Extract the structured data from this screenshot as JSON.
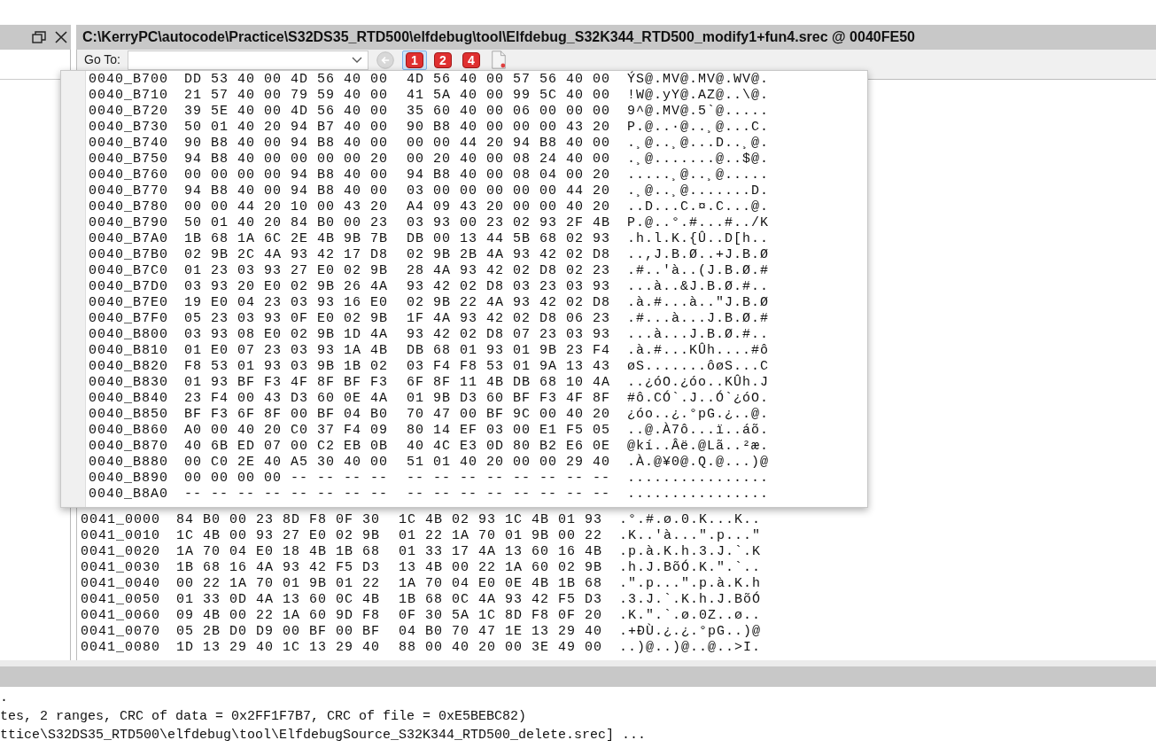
{
  "title_bar": {
    "title": "C:\\KerryPC\\autocode\\Practice\\S32DS35_RTD500\\elfdebug\\tool\\Elfdebug_S32K344_RTD500_modify1+fun4.srec @ 0040FE50"
  },
  "toolbar": {
    "goto_label": "Go To:",
    "back_disabled": true,
    "width_buttons": [
      {
        "label": "1",
        "selected": true
      },
      {
        "label": "2",
        "selected": false
      },
      {
        "label": "4",
        "selected": false
      }
    ]
  },
  "popup": {
    "rows": [
      {
        "address": "0040_B700",
        "bytes_1": "DD 53 40 00 4D 56 40 00",
        "bytes_2": "4D 56 40 00 57 56 40 00",
        "ascii": "ÝS@.MV@.MV@.WV@."
      },
      {
        "address": "0040_B710",
        "bytes_1": "21 57 40 00 79 59 40 00",
        "bytes_2": "41 5A 40 00 99 5C 40 00",
        "ascii": "!W@.yY@.AZ@..\\@."
      },
      {
        "address": "0040_B720",
        "bytes_1": "39 5E 40 00 4D 56 40 00",
        "bytes_2": "35 60 40 00 06 00 00 00",
        "ascii": "9^@.MV@.5`@....."
      },
      {
        "address": "0040_B730",
        "bytes_1": "50 01 40 20 94 B7 40 00",
        "bytes_2": "90 B8 40 00 00 00 43 20",
        "ascii": "P.@..·@..¸@...C."
      },
      {
        "address": "0040_B740",
        "bytes_1": "90 B8 40 00 94 B8 40 00",
        "bytes_2": "00 00 44 20 94 B8 40 00",
        "ascii": ".¸@..¸@...D..¸@."
      },
      {
        "address": "0040_B750",
        "bytes_1": "94 B8 40 00 00 00 00 20",
        "bytes_2": "00 20 40 00 08 24 40 00",
        "ascii": ".¸@.......@..$@."
      },
      {
        "address": "0040_B760",
        "bytes_1": "00 00 00 00 94 B8 40 00",
        "bytes_2": "94 B8 40 00 08 04 00 20",
        "ascii": ".....¸@..¸@....."
      },
      {
        "address": "0040_B770",
        "bytes_1": "94 B8 40 00 94 B8 40 00",
        "bytes_2": "03 00 00 00 00 00 44 20",
        "ascii": ".¸@..¸@.......D."
      },
      {
        "address": "0040_B780",
        "bytes_1": "00 00 44 20 10 00 43 20",
        "bytes_2": "A4 09 43 20 00 00 40 20",
        "ascii": "..D...C.¤.C...@."
      },
      {
        "address": "0040_B790",
        "bytes_1": "50 01 40 20 84 B0 00 23",
        "bytes_2": "03 93 00 23 02 93 2F 4B",
        "ascii": "P.@..°.#...#../K"
      },
      {
        "address": "0040_B7A0",
        "bytes_1": "1B 68 1A 6C 2E 4B 9B 7B",
        "bytes_2": "DB 00 13 44 5B 68 02 93",
        "ascii": ".h.l.K.{Û..D[h.."
      },
      {
        "address": "0040_B7B0",
        "bytes_1": "02 9B 2C 4A 93 42 17 D8",
        "bytes_2": "02 9B 2B 4A 93 42 02 D8",
        "ascii": "..,J.B.Ø..+J.B.Ø"
      },
      {
        "address": "0040_B7C0",
        "bytes_1": "01 23 03 93 27 E0 02 9B",
        "bytes_2": "28 4A 93 42 02 D8 02 23",
        "ascii": ".#..'à..(J.B.Ø.#"
      },
      {
        "address": "0040_B7D0",
        "bytes_1": "03 93 20 E0 02 9B 26 4A",
        "bytes_2": "93 42 02 D8 03 23 03 93",
        "ascii": "...à..&J.B.Ø.#.."
      },
      {
        "address": "0040_B7E0",
        "bytes_1": "19 E0 04 23 03 93 16 E0",
        "bytes_2": "02 9B 22 4A 93 42 02 D8",
        "ascii": ".à.#...à..\"J.B.Ø"
      },
      {
        "address": "0040_B7F0",
        "bytes_1": "05 23 03 93 0F E0 02 9B",
        "bytes_2": "1F 4A 93 42 02 D8 06 23",
        "ascii": ".#...à...J.B.Ø.#"
      },
      {
        "address": "0040_B800",
        "bytes_1": "03 93 08 E0 02 9B 1D 4A",
        "bytes_2": "93 42 02 D8 07 23 03 93",
        "ascii": "...à...J.B.Ø.#.."
      },
      {
        "address": "0040_B810",
        "bytes_1": "01 E0 07 23 03 93 1A 4B",
        "bytes_2": "DB 68 01 93 01 9B 23 F4",
        "ascii": ".à.#...KÛh....#ô"
      },
      {
        "address": "0040_B820",
        "bytes_1": "F8 53 01 93 03 9B 1B 02",
        "bytes_2": "03 F4 F8 53 01 9A 13 43",
        "ascii": "øS.......ôøS...C"
      },
      {
        "address": "0040_B830",
        "bytes_1": "01 93 BF F3 4F 8F BF F3",
        "bytes_2": "6F 8F 11 4B DB 68 10 4A",
        "ascii": "..¿óO.¿óo..KÛh.J"
      },
      {
        "address": "0040_B840",
        "bytes_1": "23 F4 00 43 D3 60 0E 4A",
        "bytes_2": "01 9B D3 60 BF F3 4F 8F",
        "ascii": "#ô.CÓ`.J..Ó`¿óO."
      },
      {
        "address": "0040_B850",
        "bytes_1": "BF F3 6F 8F 00 BF 04 B0",
        "bytes_2": "70 47 00 BF 9C 00 40 20",
        "ascii": "¿óo..¿.°pG.¿..@."
      },
      {
        "address": "0040_B860",
        "bytes_1": "A0 00 40 20 C0 37 F4 09",
        "bytes_2": "80 14 EF 03 00 E1 F5 05",
        "ascii": "..@.À7ô...ï..áõ."
      },
      {
        "address": "0040_B870",
        "bytes_1": "40 6B ED 07 00 C2 EB 0B",
        "bytes_2": "40 4C E3 0D 80 B2 E6 0E",
        "ascii": "@kí..Âë.@Lã..²æ."
      },
      {
        "address": "0040_B880",
        "bytes_1": "00 C0 2E 40 A5 30 40 00",
        "bytes_2": "51 01 40 20 00 00 29 40",
        "ascii": ".À.@¥0@.Q.@...)@"
      },
      {
        "address": "0040_B890",
        "bytes_1": "00 00 00 00 -- -- -- --",
        "bytes_2": "-- -- -- -- -- -- -- --",
        "ascii": "................"
      },
      {
        "address": "0040_B8A0",
        "bytes_1": "-- -- -- -- -- -- -- --",
        "bytes_2": "-- -- -- -- -- -- -- --",
        "ascii": "................"
      }
    ]
  },
  "hex_view": {
    "rows": [
      {
        "address": "0041_0000",
        "bytes_1": "84 B0 00 23 8D F8 0F 30",
        "bytes_2": "1C 4B 02 93 1C 4B 01 93",
        "ascii": ".°.#.ø.0.K...K.."
      },
      {
        "address": "0041_0010",
        "bytes_1": "1C 4B 00 93 27 E0 02 9B",
        "bytes_2": "01 22 1A 70 01 9B 00 22",
        "ascii": ".K..'à...\".p...\""
      },
      {
        "address": "0041_0020",
        "bytes_1": "1A 70 04 E0 18 4B 1B 68",
        "bytes_2": "01 33 17 4A 13 60 16 4B",
        "ascii": ".p.à.K.h.3.J.`.K"
      },
      {
        "address": "0041_0030",
        "bytes_1": "1B 68 16 4A 93 42 F5 D3",
        "bytes_2": "13 4B 00 22 1A 60 02 9B",
        "ascii": ".h.J.BõÓ.K.\".`.."
      },
      {
        "address": "0041_0040",
        "bytes_1": "00 22 1A 70 01 9B 01 22",
        "bytes_2": "1A 70 04 E0 0E 4B 1B 68",
        "ascii": ".\".p...\".p.à.K.h"
      },
      {
        "address": "0041_0050",
        "bytes_1": "01 33 0D 4A 13 60 0C 4B",
        "bytes_2": "1B 68 0C 4A 93 42 F5 D3",
        "ascii": ".3.J.`.K.h.J.BõÓ"
      },
      {
        "address": "0041_0060",
        "bytes_1": "09 4B 00 22 1A 60 9D F8",
        "bytes_2": "0F 30 5A 1C 8D F8 0F 20",
        "ascii": ".K.\".`.ø.0Z..ø.."
      },
      {
        "address": "0041_0070",
        "bytes_1": "05 2B D0 D9 00 BF 00 BF",
        "bytes_2": "04 B0 70 47 1E 13 29 40",
        "ascii": ".+ÐÙ.¿.¿.°pG..)@"
      },
      {
        "address": "0041_0080",
        "bytes_1": "1D 13 29 40 1C 13 29 40",
        "bytes_2": "88 00 40 20 00 3E 49 00",
        "ascii": "..)@..)@..@..>I."
      }
    ]
  },
  "log": {
    "lines": [
      ".",
      "tes, 2 ranges, CRC of data = 0x2FF1F7B7, CRC of file = 0xE5BEBC82)",
      "ttice\\S32DS35_RTD500\\elfdebug\\tool\\ElfdebugSource_S32K344_RTD500_delete.srec] ..."
    ]
  }
}
